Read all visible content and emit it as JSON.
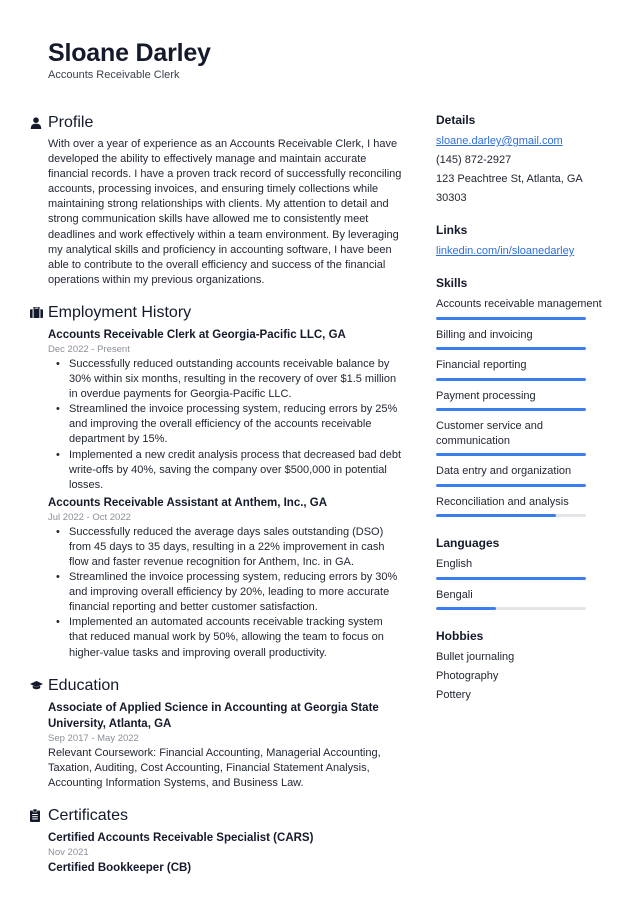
{
  "header": {
    "name": "Sloane Darley",
    "title": "Accounts Receivable Clerk"
  },
  "profile": {
    "heading": "Profile",
    "icon": "user-icon",
    "text": "With over a year of experience as an Accounts Receivable Clerk, I have developed the ability to effectively manage and maintain accurate financial records. I have a proven track record of successfully reconciling accounts, processing invoices, and ensuring timely collections while maintaining strong relationships with clients. My attention to detail and strong communication skills have allowed me to consistently meet deadlines and work effectively within a team environment. By leveraging my analytical skills and proficiency in accounting software, I have been able to contribute to the overall efficiency and success of the financial operations within my previous organizations."
  },
  "employment": {
    "heading": "Employment History",
    "icon": "briefcase-icon",
    "jobs": [
      {
        "title": "Accounts Receivable Clerk at Georgia-Pacific LLC, GA",
        "dates": "Dec 2022 - Present",
        "bullets": [
          "Successfully reduced outstanding accounts receivable balance by 30% within six months, resulting in the recovery of over $1.5 million in overdue payments for Georgia-Pacific LLC.",
          "Streamlined the invoice processing system, reducing errors by 25% and improving the overall efficiency of the accounts receivable department by 15%.",
          "Implemented a new credit analysis process that decreased bad debt write-offs by 40%, saving the company over $500,000 in potential losses."
        ]
      },
      {
        "title": "Accounts Receivable Assistant at Anthem, Inc., GA",
        "dates": "Jul 2022 - Oct 2022",
        "bullets": [
          "Successfully reduced the average days sales outstanding (DSO) from 45 days to 35 days, resulting in a 22% improvement in cash flow and faster revenue recognition for Anthem, Inc. in GA.",
          "Streamlined the invoice processing system, reducing errors by 30% and improving overall efficiency by 20%, leading to more accurate financial reporting and better customer satisfaction.",
          "Implemented an automated accounts receivable tracking system that reduced manual work by 50%, allowing the team to focus on higher-value tasks and improving overall productivity."
        ]
      }
    ]
  },
  "education": {
    "heading": "Education",
    "icon": "graduation-cap-icon",
    "items": [
      {
        "title": "Associate of Applied Science in Accounting at Georgia State University, Atlanta, GA",
        "dates": "Sep 2017 - May 2022",
        "description": "Relevant Coursework: Financial Accounting, Managerial Accounting, Taxation, Auditing, Cost Accounting, Financial Statement Analysis, Accounting Information Systems, and Business Law."
      }
    ]
  },
  "certificates": {
    "heading": "Certificates",
    "icon": "clipboard-icon",
    "items": [
      {
        "title": "Certified Accounts Receivable Specialist (CARS)",
        "date": "Nov 2021"
      },
      {
        "title": "Certified Bookkeeper (CB)",
        "date": ""
      }
    ]
  },
  "sidebar": {
    "details": {
      "heading": "Details",
      "email": "sloane.darley@gmail.com",
      "phone": "(145) 872-2927",
      "address": "123 Peachtree St, Atlanta, GA 30303"
    },
    "links": {
      "heading": "Links",
      "items": [
        "linkedin.com/in/sloanedarley"
      ]
    },
    "skills": {
      "heading": "Skills",
      "items": [
        {
          "label": "Accounts receivable management",
          "level": 100
        },
        {
          "label": "Billing and invoicing",
          "level": 100
        },
        {
          "label": "Financial reporting",
          "level": 100
        },
        {
          "label": "Payment processing",
          "level": 100
        },
        {
          "label": "Customer service and communication",
          "level": 100
        },
        {
          "label": "Data entry and organization",
          "level": 100
        },
        {
          "label": "Reconciliation and analysis",
          "level": 80
        }
      ]
    },
    "languages": {
      "heading": "Languages",
      "items": [
        {
          "label": "English",
          "level": 100
        },
        {
          "label": "Bengali",
          "level": 40
        }
      ]
    },
    "hobbies": {
      "heading": "Hobbies",
      "items": [
        "Bullet journaling",
        "Photography",
        "Pottery"
      ]
    }
  },
  "colors": {
    "accent": "#3b7ded",
    "bar_track": "#e4e5e8",
    "link": "#2f6fdb",
    "text": "#222733",
    "muted": "#8b8f99"
  }
}
